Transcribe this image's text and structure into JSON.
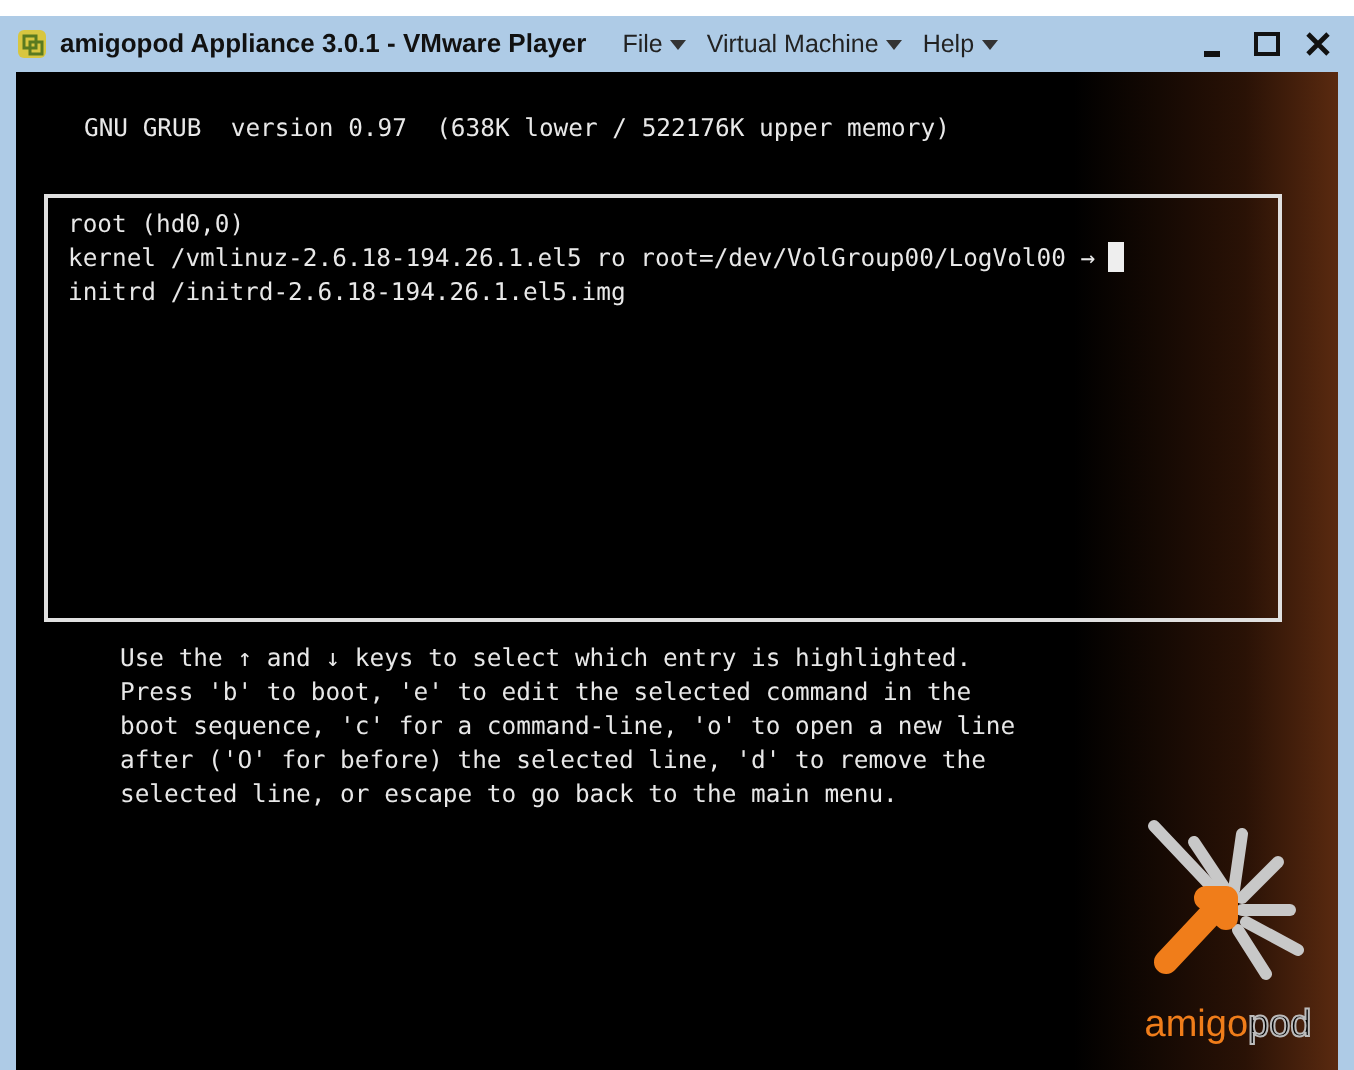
{
  "window": {
    "title": "amigopod Appliance 3.0.1 - VMware Player",
    "menus": [
      {
        "label": "File"
      },
      {
        "label": "Virtual Machine"
      },
      {
        "label": "Help"
      }
    ]
  },
  "grub": {
    "header": "GNU GRUB  version 0.97  (638K lower / 522176K upper memory)",
    "entries": [
      {
        "text": "root (hd0,0)",
        "cursor": false
      },
      {
        "text": "kernel /vmlinuz-2.6.18-194.26.1.el5 ro root=/dev/VolGroup00/LogVol00 →",
        "cursor": true
      },
      {
        "text": "initrd /initrd-2.6.18-194.26.1.el5.img",
        "cursor": false
      }
    ],
    "help_lines": [
      "Use the ↑ and ↓ keys to select which entry is highlighted.",
      "Press 'b' to boot, 'e' to edit the selected command in the",
      "boot sequence, 'c' for a command-line, 'o' to open a new line",
      "after ('O' for before) the selected line, 'd' to remove the",
      "selected line, or escape to go back to the main menu."
    ]
  },
  "logo": {
    "parts": [
      "amigo",
      "pod"
    ]
  }
}
